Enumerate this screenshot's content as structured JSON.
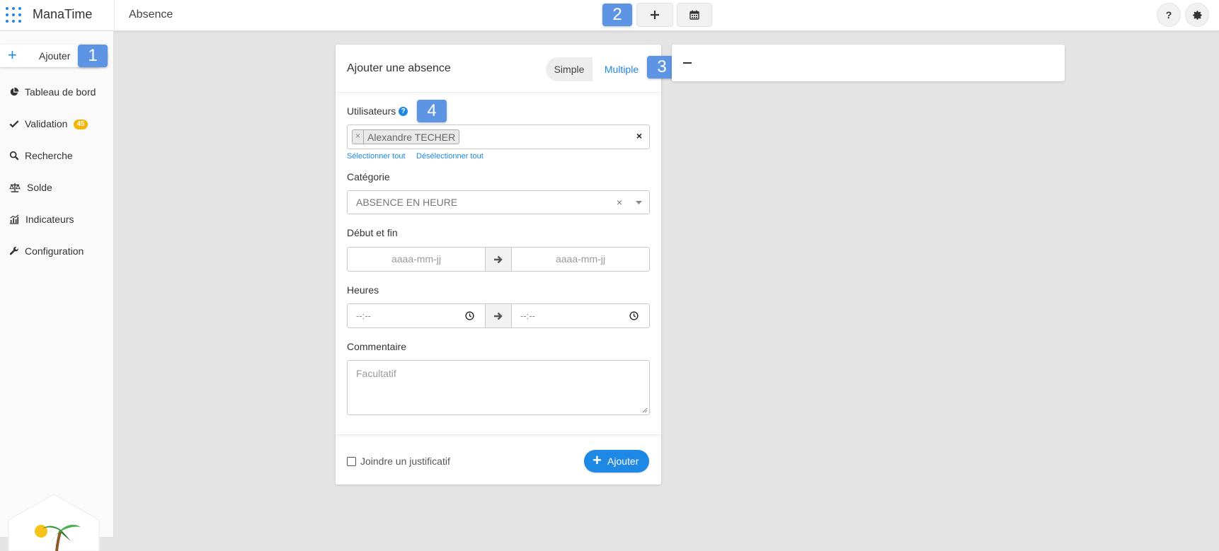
{
  "app": {
    "brand": "ManaTime",
    "page_title": "Absence"
  },
  "annotations": {
    "step1": "1",
    "step2": "2",
    "step3": "3",
    "step4": "4"
  },
  "topbar": {
    "add_icon": "plus-icon",
    "calendar_icon": "calendar-icon",
    "help_label": "?",
    "settings_icon": "gear-icon"
  },
  "sidebar": {
    "add_label": "Ajouter",
    "items": [
      {
        "label": "Tableau de bord",
        "icon": "pie-chart-icon"
      },
      {
        "label": "Validation",
        "icon": "check-icon",
        "badge": "45"
      },
      {
        "label": "Recherche",
        "icon": "search-icon"
      },
      {
        "label": "Solde",
        "icon": "balance-scale-icon"
      },
      {
        "label": "Indicateurs",
        "icon": "bar-chart-icon"
      },
      {
        "label": "Configuration",
        "icon": "wrench-icon"
      }
    ]
  },
  "form": {
    "title": "Ajouter une absence",
    "mode_simple": "Simple",
    "mode_multiple": "Multiple",
    "users_label": "Utilisateurs",
    "users_help": "?",
    "selected_user": "Alexandre TECHER",
    "chip_remove": "×",
    "clear_all": "×",
    "select_all": "Sélectionner tout",
    "deselect_all": "Désélectionner tout",
    "category_label": "Catégorie",
    "category_value": "ABSENCE EN HEURE",
    "category_clear": "×",
    "dates_label": "Début et fin",
    "date_start_placeholder": "aaaa-mm-jj",
    "date_end_placeholder": "aaaa-mm-jj",
    "hours_label": "Heures",
    "time_start_value": "--:--",
    "time_end_value": "--:--",
    "comment_label": "Commentaire",
    "comment_placeholder": "Facultatif",
    "attach_label": "Joindre un justificatif",
    "submit_label": "Ajouter"
  },
  "colors": {
    "accent": "#1e88e5",
    "badge": "#f4b400",
    "annotation": "#5e94e4",
    "background": "#e4e4e4"
  }
}
